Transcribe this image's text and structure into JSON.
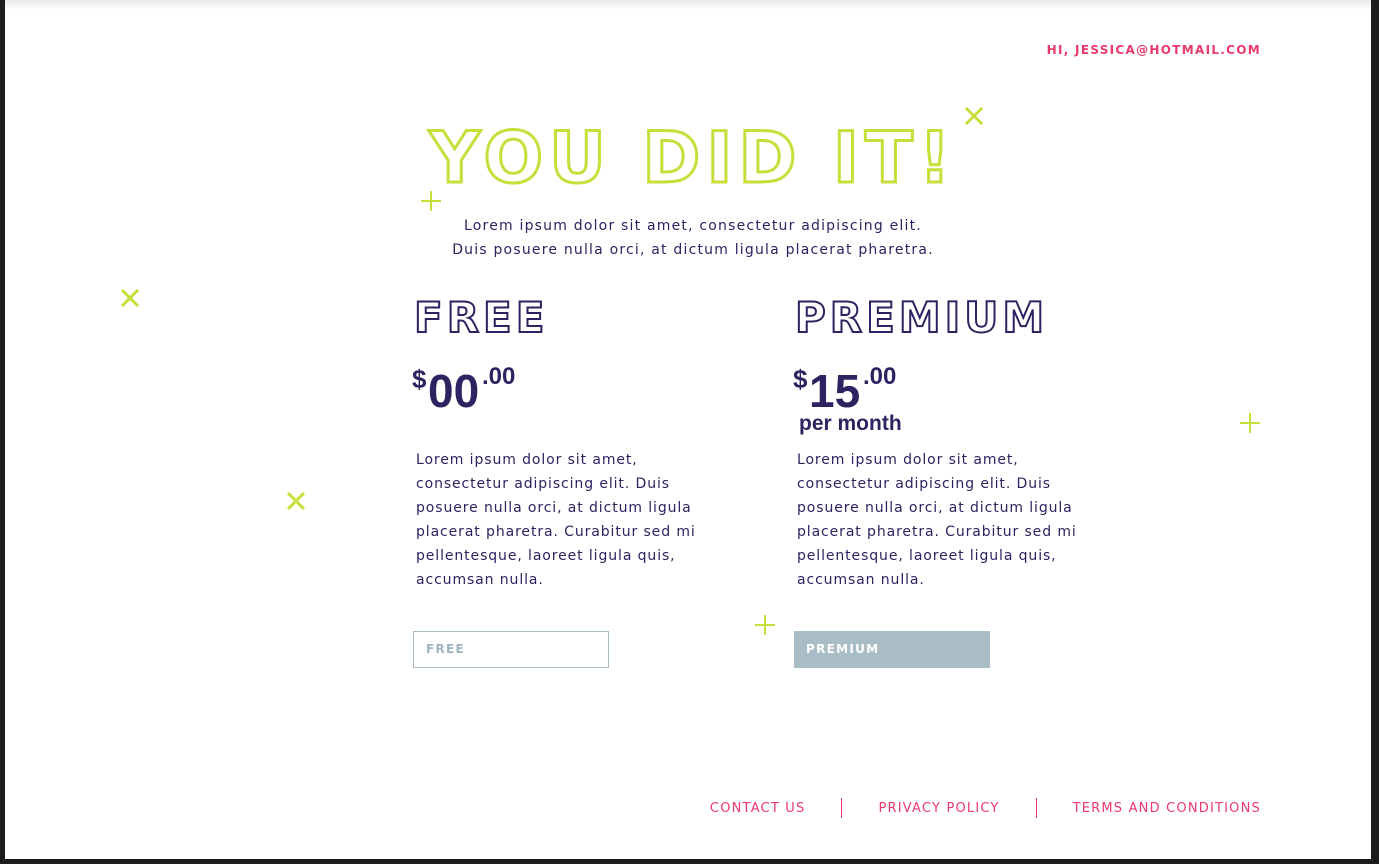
{
  "header": {
    "greeting": "HI, JESSICA@HOTMAIL.COM"
  },
  "hero": {
    "title": "YOU DID IT!",
    "subtitle_line1": "Lorem ipsum dolor sit amet, consectetur adipiscing elit.",
    "subtitle_line2": "Duis posuere nulla orci, at dictum ligula placerat pharetra."
  },
  "plans": [
    {
      "name": "FREE",
      "currency": "$",
      "price_whole": "00",
      "price_cents": ".00",
      "period": "",
      "description": "Lorem ipsum dolor sit amet, consectetur adipiscing elit. Duis posuere nulla orci, at dictum ligula placerat pharetra. Curabitur sed mi pellentesque, laoreet ligula quis, accumsan nulla.",
      "button_label": "FREE"
    },
    {
      "name": "PREMIUM",
      "currency": "$",
      "price_whole": "15",
      "price_cents": ".00",
      "period": "per month",
      "description": "Lorem ipsum dolor sit amet, consectetur adipiscing elit. Duis posuere nulla orci, at dictum ligula placerat pharetra. Curabitur sed mi pellentesque, laoreet ligula quis, accumsan nulla.",
      "button_label": "PREMIUM"
    }
  ],
  "footer": {
    "links": [
      "CONTACT US",
      "PRIVACY POLICY",
      "TERMS AND CONDITIONS"
    ]
  },
  "decorations": {
    "icons": [
      "cross-icon",
      "plus-icon"
    ]
  },
  "colors": {
    "accent_pink": "#ea3a6c",
    "accent_lime": "#c8de3a",
    "navy": "#2b2460",
    "button_grey": "#a8bdc5"
  }
}
